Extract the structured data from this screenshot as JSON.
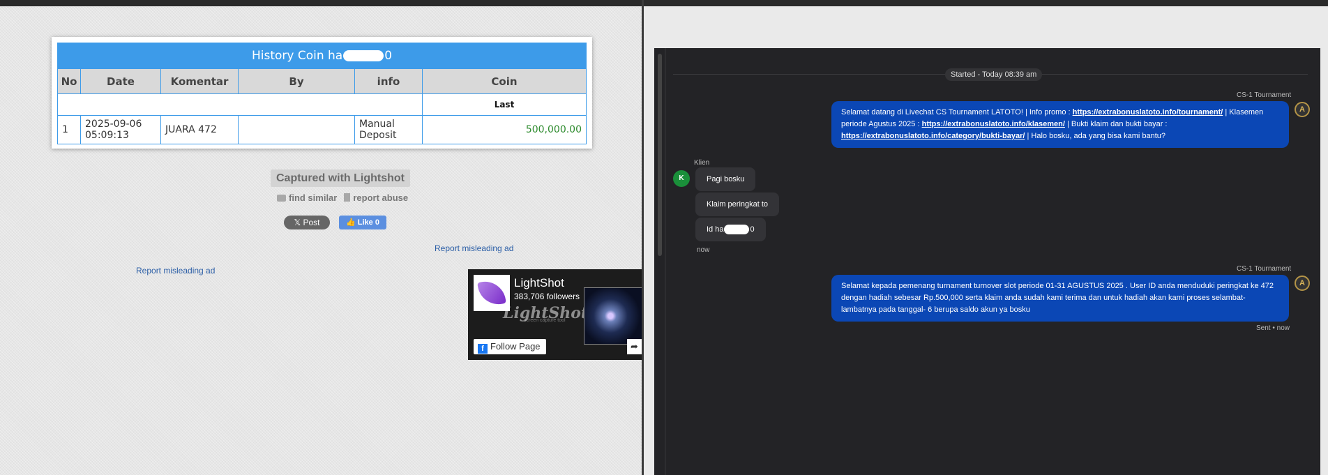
{
  "left": {
    "table": {
      "title_prefix": "History Coin ha",
      "title_suffix": "0",
      "headers": [
        "No",
        "Date",
        "Komentar",
        "By",
        "info",
        "Coin"
      ],
      "last_label": "Last",
      "row": {
        "no": "1",
        "date_line1": "2025-09-06",
        "date_line2": "05:09:13",
        "komentar": "JUARA 472",
        "by": "",
        "info_line1": "Manual",
        "info_line2": "Deposit",
        "coin": "500,000.00"
      }
    },
    "captured_label": "Captured with Lightshot",
    "find_similar": "find similar",
    "report_abuse": "report abuse",
    "x_post": "Post",
    "fb_like": "Like 0",
    "report_ad_1": "Report misleading ad",
    "report_ad_2": "Report misleading ad",
    "fb_page": {
      "name": "LightShot",
      "followers": "383,706 followers",
      "watermark": "LightShot",
      "watermark_sub": "screen capture tool",
      "follow_label": "Follow Page"
    }
  },
  "chat": {
    "started": "Started - Today 08:39 am",
    "agent_name_1": "CS-1 Tournament",
    "agent_msg_1": {
      "t1": "Selamat datang di Livechat CS Tournament LATOTO! | Info promo : ",
      "link1": "https://extrabonuslatoto.info/tournament/",
      "t2": " | Klasemen periode Agustus 2025 : ",
      "link2": "https://extrabonuslatoto.info/klasemen/",
      "t3": " | Bukti klaim dan bukti bayar : ",
      "link3": "https://extrabonuslatoto.info/category/bukti-bayar/",
      "t4": " | Halo bosku, ada yang bisa kami bantu?"
    },
    "client_label": "Klien",
    "client_initial": "K",
    "client_msgs": [
      "Pagi bosku",
      "Klaim peringkat to"
    ],
    "client_msg_3_prefix": "Id ha",
    "client_msg_3_suffix": "0",
    "client_time": "now",
    "agent_name_2": "CS-1 Tournament",
    "agent_msg_2": "Selamat kepada pemenang turnament turnover slot periode 01-31 AGUSTUS 2025 . User ID anda menduduki peringkat ke 472 dengan hadiah sebesar Rp.500,000 serta klaim anda sudah kami terima dan untuk hadiah akan kami proses selambat-lambatnya pada tanggal- 6 berupa saldo akun ya bosku",
    "sent_status": "Sent • now",
    "agent_avatar": "A"
  }
}
